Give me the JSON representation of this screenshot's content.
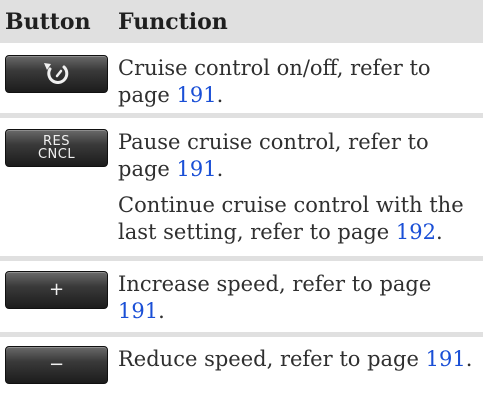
{
  "header": {
    "col_button": "Button",
    "col_function": "Function"
  },
  "rows": [
    {
      "button": {
        "icon": "cruise-control-icon"
      },
      "lines": [
        {
          "text": "Cruise control on/off, refer to page ",
          "ref": "191",
          "suffix": "."
        }
      ]
    },
    {
      "button": {
        "label_top": "RES",
        "label_bottom": "CNCL"
      },
      "lines": [
        {
          "text": "Pause cruise control, refer to page ",
          "ref": "191",
          "suffix": "."
        },
        {
          "text": "Continue cruise control with the last setting, refer to page ",
          "ref": "192",
          "suffix": "."
        }
      ]
    },
    {
      "button": {
        "symbol": "+"
      },
      "lines": [
        {
          "text": "Increase speed, refer to page ",
          "ref": "191",
          "suffix": "."
        }
      ]
    },
    {
      "button": {
        "symbol": "−"
      },
      "lines": [
        {
          "text": "Reduce speed, refer to page ",
          "ref": "191",
          "suffix": "."
        }
      ]
    }
  ],
  "colors": {
    "header_bg": "#e0e0e0",
    "link": "#1a4fd6",
    "button_dark": "#1c1c1c"
  }
}
